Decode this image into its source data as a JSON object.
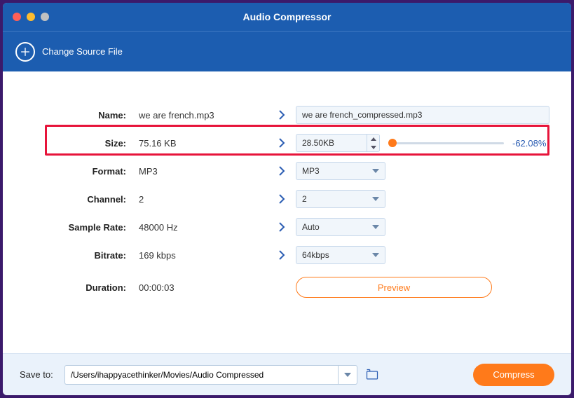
{
  "window": {
    "title": "Audio Compressor"
  },
  "header": {
    "change_source_label": "Change Source File"
  },
  "rows": {
    "name": {
      "label": "Name:",
      "orig": "we are french.mp3",
      "dest": "we are french_compressed.mp3"
    },
    "size": {
      "label": "Size:",
      "orig": "75.16 KB",
      "dest": "28.50KB",
      "delta": "-62.08%"
    },
    "format": {
      "label": "Format:",
      "orig": "MP3",
      "dest": "MP3"
    },
    "channel": {
      "label": "Channel:",
      "orig": "2",
      "dest": "2"
    },
    "sample_rate": {
      "label": "Sample Rate:",
      "orig": "48000 Hz",
      "dest": "Auto"
    },
    "bitrate": {
      "label": "Bitrate:",
      "orig": "169 kbps",
      "dest": "64kbps"
    },
    "duration": {
      "label": "Duration:",
      "orig": "00:00:03"
    }
  },
  "buttons": {
    "preview": "Preview",
    "compress": "Compress"
  },
  "footer": {
    "save_to_label": "Save to:",
    "path": "/Users/ihappyacethinker/Movies/Audio Compressed"
  }
}
